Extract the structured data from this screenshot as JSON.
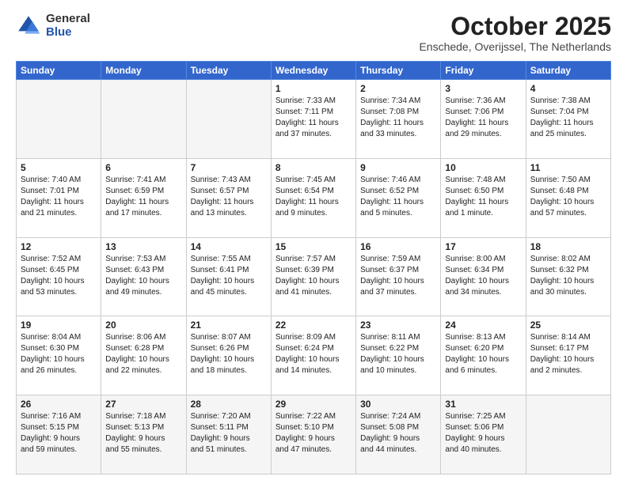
{
  "logo": {
    "general": "General",
    "blue": "Blue"
  },
  "title": "October 2025",
  "location": "Enschede, Overijssel, The Netherlands",
  "weekdays": [
    "Sunday",
    "Monday",
    "Tuesday",
    "Wednesday",
    "Thursday",
    "Friday",
    "Saturday"
  ],
  "weeks": [
    [
      {
        "day": "",
        "info": ""
      },
      {
        "day": "",
        "info": ""
      },
      {
        "day": "",
        "info": ""
      },
      {
        "day": "1",
        "info": "Sunrise: 7:33 AM\nSunset: 7:11 PM\nDaylight: 11 hours\nand 37 minutes."
      },
      {
        "day": "2",
        "info": "Sunrise: 7:34 AM\nSunset: 7:08 PM\nDaylight: 11 hours\nand 33 minutes."
      },
      {
        "day": "3",
        "info": "Sunrise: 7:36 AM\nSunset: 7:06 PM\nDaylight: 11 hours\nand 29 minutes."
      },
      {
        "day": "4",
        "info": "Sunrise: 7:38 AM\nSunset: 7:04 PM\nDaylight: 11 hours\nand 25 minutes."
      }
    ],
    [
      {
        "day": "5",
        "info": "Sunrise: 7:40 AM\nSunset: 7:01 PM\nDaylight: 11 hours\nand 21 minutes."
      },
      {
        "day": "6",
        "info": "Sunrise: 7:41 AM\nSunset: 6:59 PM\nDaylight: 11 hours\nand 17 minutes."
      },
      {
        "day": "7",
        "info": "Sunrise: 7:43 AM\nSunset: 6:57 PM\nDaylight: 11 hours\nand 13 minutes."
      },
      {
        "day": "8",
        "info": "Sunrise: 7:45 AM\nSunset: 6:54 PM\nDaylight: 11 hours\nand 9 minutes."
      },
      {
        "day": "9",
        "info": "Sunrise: 7:46 AM\nSunset: 6:52 PM\nDaylight: 11 hours\nand 5 minutes."
      },
      {
        "day": "10",
        "info": "Sunrise: 7:48 AM\nSunset: 6:50 PM\nDaylight: 11 hours\nand 1 minute."
      },
      {
        "day": "11",
        "info": "Sunrise: 7:50 AM\nSunset: 6:48 PM\nDaylight: 10 hours\nand 57 minutes."
      }
    ],
    [
      {
        "day": "12",
        "info": "Sunrise: 7:52 AM\nSunset: 6:45 PM\nDaylight: 10 hours\nand 53 minutes."
      },
      {
        "day": "13",
        "info": "Sunrise: 7:53 AM\nSunset: 6:43 PM\nDaylight: 10 hours\nand 49 minutes."
      },
      {
        "day": "14",
        "info": "Sunrise: 7:55 AM\nSunset: 6:41 PM\nDaylight: 10 hours\nand 45 minutes."
      },
      {
        "day": "15",
        "info": "Sunrise: 7:57 AM\nSunset: 6:39 PM\nDaylight: 10 hours\nand 41 minutes."
      },
      {
        "day": "16",
        "info": "Sunrise: 7:59 AM\nSunset: 6:37 PM\nDaylight: 10 hours\nand 37 minutes."
      },
      {
        "day": "17",
        "info": "Sunrise: 8:00 AM\nSunset: 6:34 PM\nDaylight: 10 hours\nand 34 minutes."
      },
      {
        "day": "18",
        "info": "Sunrise: 8:02 AM\nSunset: 6:32 PM\nDaylight: 10 hours\nand 30 minutes."
      }
    ],
    [
      {
        "day": "19",
        "info": "Sunrise: 8:04 AM\nSunset: 6:30 PM\nDaylight: 10 hours\nand 26 minutes."
      },
      {
        "day": "20",
        "info": "Sunrise: 8:06 AM\nSunset: 6:28 PM\nDaylight: 10 hours\nand 22 minutes."
      },
      {
        "day": "21",
        "info": "Sunrise: 8:07 AM\nSunset: 6:26 PM\nDaylight: 10 hours\nand 18 minutes."
      },
      {
        "day": "22",
        "info": "Sunrise: 8:09 AM\nSunset: 6:24 PM\nDaylight: 10 hours\nand 14 minutes."
      },
      {
        "day": "23",
        "info": "Sunrise: 8:11 AM\nSunset: 6:22 PM\nDaylight: 10 hours\nand 10 minutes."
      },
      {
        "day": "24",
        "info": "Sunrise: 8:13 AM\nSunset: 6:20 PM\nDaylight: 10 hours\nand 6 minutes."
      },
      {
        "day": "25",
        "info": "Sunrise: 8:14 AM\nSunset: 6:17 PM\nDaylight: 10 hours\nand 2 minutes."
      }
    ],
    [
      {
        "day": "26",
        "info": "Sunrise: 7:16 AM\nSunset: 5:15 PM\nDaylight: 9 hours\nand 59 minutes."
      },
      {
        "day": "27",
        "info": "Sunrise: 7:18 AM\nSunset: 5:13 PM\nDaylight: 9 hours\nand 55 minutes."
      },
      {
        "day": "28",
        "info": "Sunrise: 7:20 AM\nSunset: 5:11 PM\nDaylight: 9 hours\nand 51 minutes."
      },
      {
        "day": "29",
        "info": "Sunrise: 7:22 AM\nSunset: 5:10 PM\nDaylight: 9 hours\nand 47 minutes."
      },
      {
        "day": "30",
        "info": "Sunrise: 7:24 AM\nSunset: 5:08 PM\nDaylight: 9 hours\nand 44 minutes."
      },
      {
        "day": "31",
        "info": "Sunrise: 7:25 AM\nSunset: 5:06 PM\nDaylight: 9 hours\nand 40 minutes."
      },
      {
        "day": "",
        "info": ""
      }
    ]
  ]
}
